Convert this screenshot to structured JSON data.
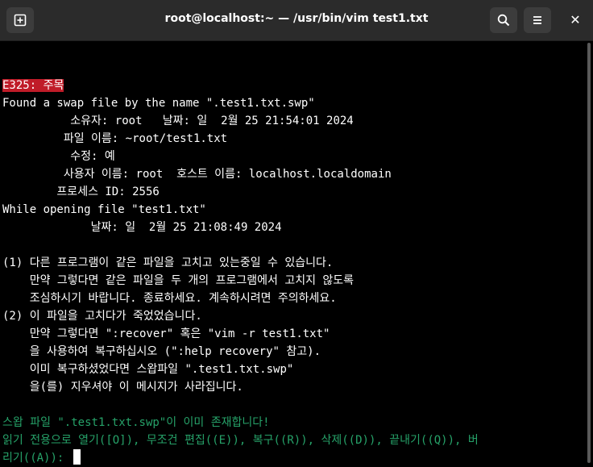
{
  "window": {
    "title": "root@localhost:~ — /usr/bin/vim test1.txt",
    "new_tab_icon": "new-tab-icon",
    "search_icon": "search-icon",
    "menu_icon": "hamburger-menu-icon",
    "close_glyph": "✕"
  },
  "colors": {
    "background": "#000000",
    "titlebar": "#2b2b2b",
    "error_bg": "#c01c28",
    "prompt_green": "#26a269"
  },
  "terminal": {
    "lines": [
      "E325: 주목",
      "Found a swap file by the name \".test1.txt.swp\"",
      "          소유자: root   날짜: 일  2월 25 21:54:01 2024",
      "         파일 이름: ~root/test1.txt",
      "          수정: 예",
      "         사용자 이름: root  호스트 이름: localhost.localdomain",
      "        프로세스 ID: 2556",
      "While opening file \"test1.txt\"",
      "             날짜: 일  2월 25 21:08:49 2024",
      "",
      "(1) 다른 프로그램이 같은 파일을 고치고 있는중일 수 있습니다.",
      "    만약 그렇다면 같은 파일을 두 개의 프로그램에서 고치지 않도록",
      "    조심하시기 바랍니다. 종료하세요. 계속하시려면 주의하세요.",
      "(2) 이 파일을 고치다가 죽었었습니다.",
      "    만약 그렇다면 \":recover\" 혹은 \"vim -r test1.txt\"",
      "    을 사용하여 복구하십시오 (\":help recovery\" 참고).",
      "    이미 복구하셨었다면 스왑파일 \".test1.txt.swp\"",
      "    을(를) 지우셔야 이 메시지가 사라집니다.",
      "",
      "스왑 파일 \".test1.txt.swp\"이 이미 존재합니다!",
      "읽기 전용으로 열기([O]), 무조건 편집((E)), 복구((R)), 삭제((D)), 끝내기((Q)), 버",
      "리기((A)): "
    ]
  }
}
